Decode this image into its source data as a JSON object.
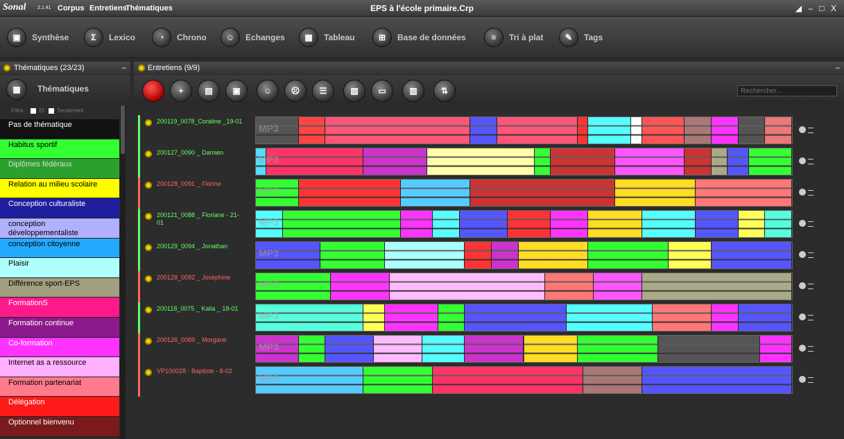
{
  "app": {
    "logo": "Sonal",
    "version": "2.1.41",
    "menus": [
      "Corpus",
      "Entretiens",
      "Thématiques"
    ],
    "window_title": "EPS à l'école primaire.Crp",
    "window_controls": "◢ ‒ □ X"
  },
  "toolbar": [
    {
      "label": "Synthèse",
      "icon": "synthese-icon",
      "glyph": "▣"
    },
    {
      "label": "Lexico",
      "icon": "sigma-icon",
      "glyph": "Σ"
    },
    {
      "label": "Chrono",
      "icon": "pie-icon",
      "glyph": "◔"
    },
    {
      "label": "Echanges",
      "icon": "people-icon",
      "glyph": "☺"
    },
    {
      "label": "Tableau",
      "icon": "table-icon",
      "glyph": "▦"
    },
    {
      "label": "Base de données",
      "icon": "grid-icon",
      "glyph": "⊞"
    },
    {
      "label": "Tri à plat",
      "icon": "sort-icon",
      "glyph": "≡"
    },
    {
      "label": "Tags",
      "icon": "tag-icon",
      "glyph": "✎"
    }
  ],
  "left": {
    "header": "Thématiques (23/23)",
    "button": "Thématiques",
    "filter": {
      "label": "Filtre :",
      "et": "Et",
      "seulement": "Seulement"
    },
    "themes": [
      {
        "label": "Pas de thématique",
        "bg": "#111111",
        "fg": "#ffffff"
      },
      {
        "label": "Habitus sportif",
        "bg": "#33ff33",
        "fg": "#000000"
      },
      {
        "label": "Diplômes fédéraux",
        "bg": "#2ca02c",
        "fg": "#dddddd"
      },
      {
        "label": "Relation au milieu scolaire",
        "bg": "#ffff00",
        "fg": "#000000"
      },
      {
        "label": "Conception culturaliste",
        "bg": "#1f1fa0",
        "fg": "#ffffff"
      },
      {
        "label": "conception développementaliste",
        "bg": "#b0b0ff",
        "fg": "#000000"
      },
      {
        "label": "conception citoyenne",
        "bg": "#22aaff",
        "fg": "#000000"
      },
      {
        "label": "Plaisir",
        "bg": "#b0ffff",
        "fg": "#000000"
      },
      {
        "label": "Différence sport-EPS",
        "bg": "#a0a080",
        "fg": "#000000"
      },
      {
        "label": "FormationS",
        "bg": "#ff1a8c",
        "fg": "#ffffff"
      },
      {
        "label": "Formation continue",
        "bg": "#8c1a8c",
        "fg": "#ffffff"
      },
      {
        "label": "Co-formation",
        "bg": "#ff33ff",
        "fg": "#ffffff"
      },
      {
        "label": "Internet as a ressource",
        "bg": "#ffb0ff",
        "fg": "#000000"
      },
      {
        "label": "Formation partenariat",
        "bg": "#ff7a8c",
        "fg": "#000000"
      },
      {
        "label": "Délégation",
        "bg": "#ff1a1a",
        "fg": "#ffffff"
      },
      {
        "label": "Optionnel bienvenu",
        "bg": "#7a1a1a",
        "fg": "#ffffff"
      }
    ]
  },
  "right": {
    "header": "Entretiens (9/9)",
    "search_placeholder": "Rechercher...",
    "mp3_label": "MP3",
    "interviews": [
      {
        "label": "200119_0078_Coraline _19-01",
        "color": "#6f6",
        "segs": [
          [
            0,
            8,
            "#555"
          ],
          [
            8,
            13,
            "#f44"
          ],
          [
            13,
            40,
            "#f57"
          ],
          [
            40,
            45,
            "#55f"
          ],
          [
            45,
            60,
            "#f57"
          ],
          [
            60,
            62,
            "#f33"
          ],
          [
            62,
            70,
            "#5ff"
          ],
          [
            70,
            72,
            "#fff"
          ],
          [
            72,
            80,
            "#f55"
          ],
          [
            80,
            85,
            "#a77"
          ],
          [
            85,
            90,
            "#f3f"
          ],
          [
            90,
            95,
            "#555"
          ],
          [
            95,
            100,
            "#e77"
          ]
        ]
      },
      {
        "label": "200127_0090 _ Damien",
        "color": "#6f6",
        "segs": [
          [
            0,
            2,
            "#5df"
          ],
          [
            2,
            20,
            "#f36"
          ],
          [
            20,
            32,
            "#c3c"
          ],
          [
            32,
            52,
            "#ffa"
          ],
          [
            52,
            55,
            "#3f3"
          ],
          [
            55,
            67,
            "#c33"
          ],
          [
            67,
            80,
            "#f5f"
          ],
          [
            80,
            85,
            "#c33"
          ],
          [
            85,
            88,
            "#aa8"
          ],
          [
            88,
            92,
            "#55f"
          ],
          [
            92,
            100,
            "#3f3"
          ]
        ]
      },
      {
        "label": "200128_0091 _ Florine",
        "color": "#f66",
        "segs": [
          [
            0,
            8,
            "#3f3"
          ],
          [
            8,
            27,
            "#f33"
          ],
          [
            27,
            40,
            "#5cf"
          ],
          [
            40,
            67,
            "#c33"
          ],
          [
            67,
            82,
            "#fd2"
          ],
          [
            82,
            100,
            "#f77"
          ]
        ]
      },
      {
        "label": "200121_0088 _ Floriane - 21-01",
        "color": "#6f6",
        "segs": [
          [
            0,
            5,
            "#5ff"
          ],
          [
            5,
            27,
            "#3f3"
          ],
          [
            27,
            33,
            "#f3f"
          ],
          [
            33,
            38,
            "#5ff"
          ],
          [
            38,
            47,
            "#55f"
          ],
          [
            47,
            55,
            "#f33"
          ],
          [
            55,
            62,
            "#f3f"
          ],
          [
            62,
            72,
            "#fd2"
          ],
          [
            72,
            82,
            "#5ff"
          ],
          [
            82,
            90,
            "#55f"
          ],
          [
            90,
            95,
            "#ff5"
          ],
          [
            95,
            100,
            "#5fd"
          ]
        ]
      },
      {
        "label": "200129_0094 _ Jonathan",
        "color": "#6f6",
        "segs": [
          [
            0,
            12,
            "#55f"
          ],
          [
            12,
            24,
            "#3f3"
          ],
          [
            24,
            39,
            "#aff"
          ],
          [
            39,
            44,
            "#f33"
          ],
          [
            44,
            49,
            "#c3c"
          ],
          [
            49,
            62,
            "#fd2"
          ],
          [
            62,
            77,
            "#3f3"
          ],
          [
            77,
            85,
            "#ff5"
          ],
          [
            85,
            100,
            "#55f"
          ]
        ]
      },
      {
        "label": "200128_0092 _ Joséphine",
        "color": "#f66",
        "segs": [
          [
            0,
            14,
            "#3f3"
          ],
          [
            14,
            25,
            "#f3f"
          ],
          [
            25,
            54,
            "#fbf"
          ],
          [
            54,
            63,
            "#f77"
          ],
          [
            63,
            72,
            "#f5f"
          ],
          [
            72,
            100,
            "#aa8"
          ]
        ]
      },
      {
        "label": "200118_0075 _ Kalia _ 18-01",
        "color": "#6f6",
        "segs": [
          [
            0,
            20,
            "#5fd"
          ],
          [
            20,
            24,
            "#ff5"
          ],
          [
            24,
            34,
            "#f3f"
          ],
          [
            34,
            39,
            "#3f3"
          ],
          [
            39,
            58,
            "#55f"
          ],
          [
            58,
            74,
            "#5ff"
          ],
          [
            74,
            85,
            "#f77"
          ],
          [
            85,
            90,
            "#f3f"
          ],
          [
            90,
            100,
            "#55f"
          ]
        ]
      },
      {
        "label": "200126_0089 _ Morgane",
        "color": "#f66",
        "segs": [
          [
            0,
            8,
            "#c3c"
          ],
          [
            8,
            13,
            "#3f3"
          ],
          [
            13,
            22,
            "#55f"
          ],
          [
            22,
            31,
            "#fbf"
          ],
          [
            31,
            39,
            "#5ff"
          ],
          [
            39,
            50,
            "#c3c"
          ],
          [
            50,
            60,
            "#fd2"
          ],
          [
            60,
            75,
            "#3f3"
          ],
          [
            75,
            94,
            "#555"
          ],
          [
            94,
            100,
            "#f3f"
          ]
        ]
      },
      {
        "label": "VP100028 - Baptiste - 8-02",
        "color": "#f66",
        "segs": [
          [
            0,
            20,
            "#5cf"
          ],
          [
            20,
            33,
            "#3f3"
          ],
          [
            33,
            61,
            "#f36"
          ],
          [
            61,
            72,
            "#a77"
          ],
          [
            72,
            100,
            "#55f"
          ]
        ]
      }
    ]
  }
}
